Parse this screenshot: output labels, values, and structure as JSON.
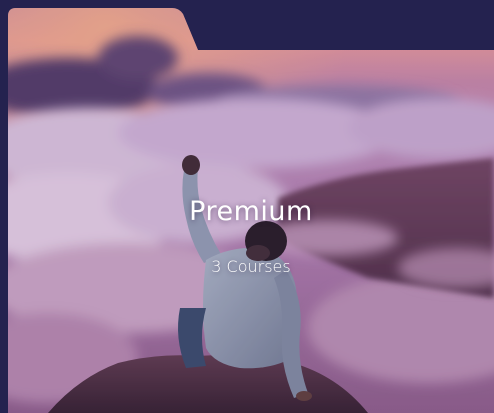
{
  "colors": {
    "page_background": "#24224f",
    "text": "#ffffff"
  },
  "course_folder": {
    "title": "Premium",
    "subtitle": "3 Courses",
    "image_icon": "person-on-mountain-above-clouds-image"
  }
}
